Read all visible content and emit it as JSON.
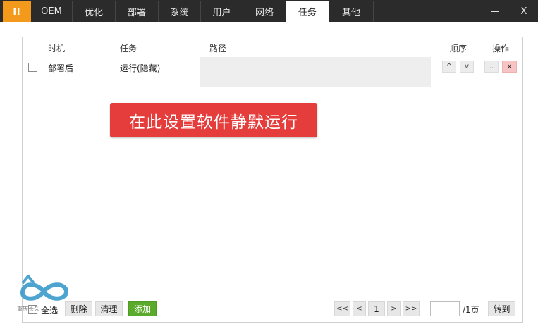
{
  "titlebar": {
    "pause_label": "II",
    "tabs": [
      "OEM",
      "优化",
      "部署",
      "系统",
      "用户",
      "网络",
      "任务",
      "其他"
    ],
    "active_tab": "任务",
    "minimize_label": "—",
    "close_label": "X"
  },
  "table": {
    "headers": {
      "timing": "时机",
      "task": "任务",
      "path": "路径",
      "order": "顺序",
      "action": "操作"
    },
    "rows": [
      {
        "timing": "部署后",
        "task": "运行(隐藏)",
        "path": "",
        "up": "^",
        "down": "v",
        "browse": "..",
        "delete": "x"
      }
    ]
  },
  "banner": "在此设置软件静默运行",
  "footer": {
    "select_all": "全选",
    "delete": "删除",
    "clear": "清理",
    "add": "添加",
    "first": "<<",
    "prev": "<",
    "page": "1",
    "next": ">",
    "last": ">>",
    "page_input": "",
    "total": "/1页",
    "goto": "转到"
  },
  "watermark": {
    "icon": "infinity-logo-icon",
    "text": "重庆长久"
  },
  "colors": {
    "accent": "#f39a1d",
    "add_button": "#5aab2b",
    "banner": "#e53c3c",
    "delete_button": "#f6c4c4"
  }
}
